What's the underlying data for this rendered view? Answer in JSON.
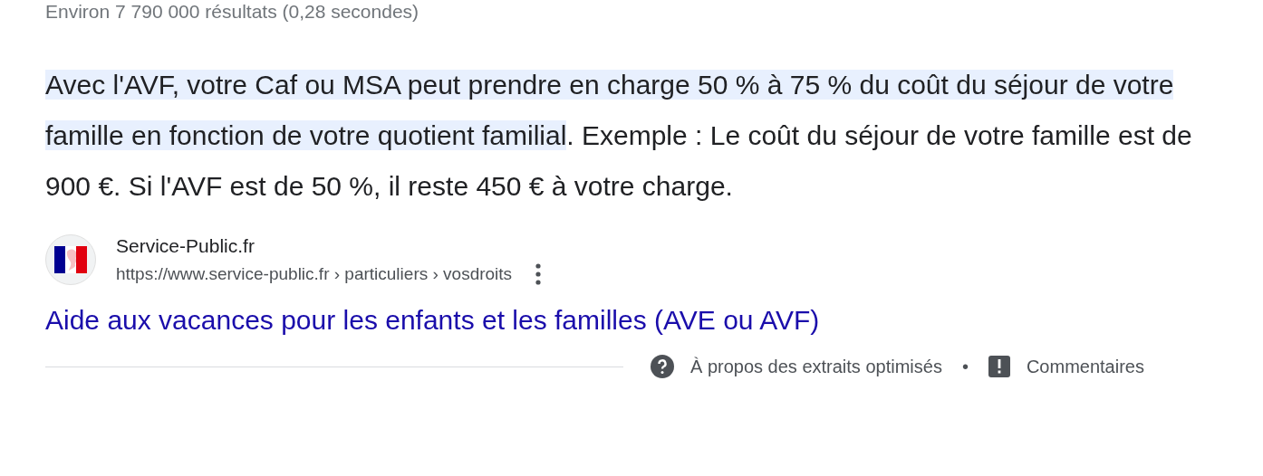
{
  "result_stats": "Environ 7 790 000 résultats (0,28 secondes)",
  "snippet": {
    "highlighted": "Avec l'AVF, votre Caf ou MSA peut prendre en charge 50 % à 75 % du coût du séjour de votre famille en fonction de votre quotient familial",
    "rest": ". Exemple : Le coût du séjour de votre famille est de 900 €. Si l'AVF est de 50 %, il reste 450 € à votre charge."
  },
  "source": {
    "site_name": "Service-Public.fr",
    "url": "https://www.service-public.fr › particuliers › vosdroits",
    "title": "Aide aux vacances pour les enfants et les familles (AVE ou AVF)"
  },
  "footer": {
    "about": "À propos des extraits optimisés",
    "separator": "•",
    "feedback": "Commentaires"
  }
}
